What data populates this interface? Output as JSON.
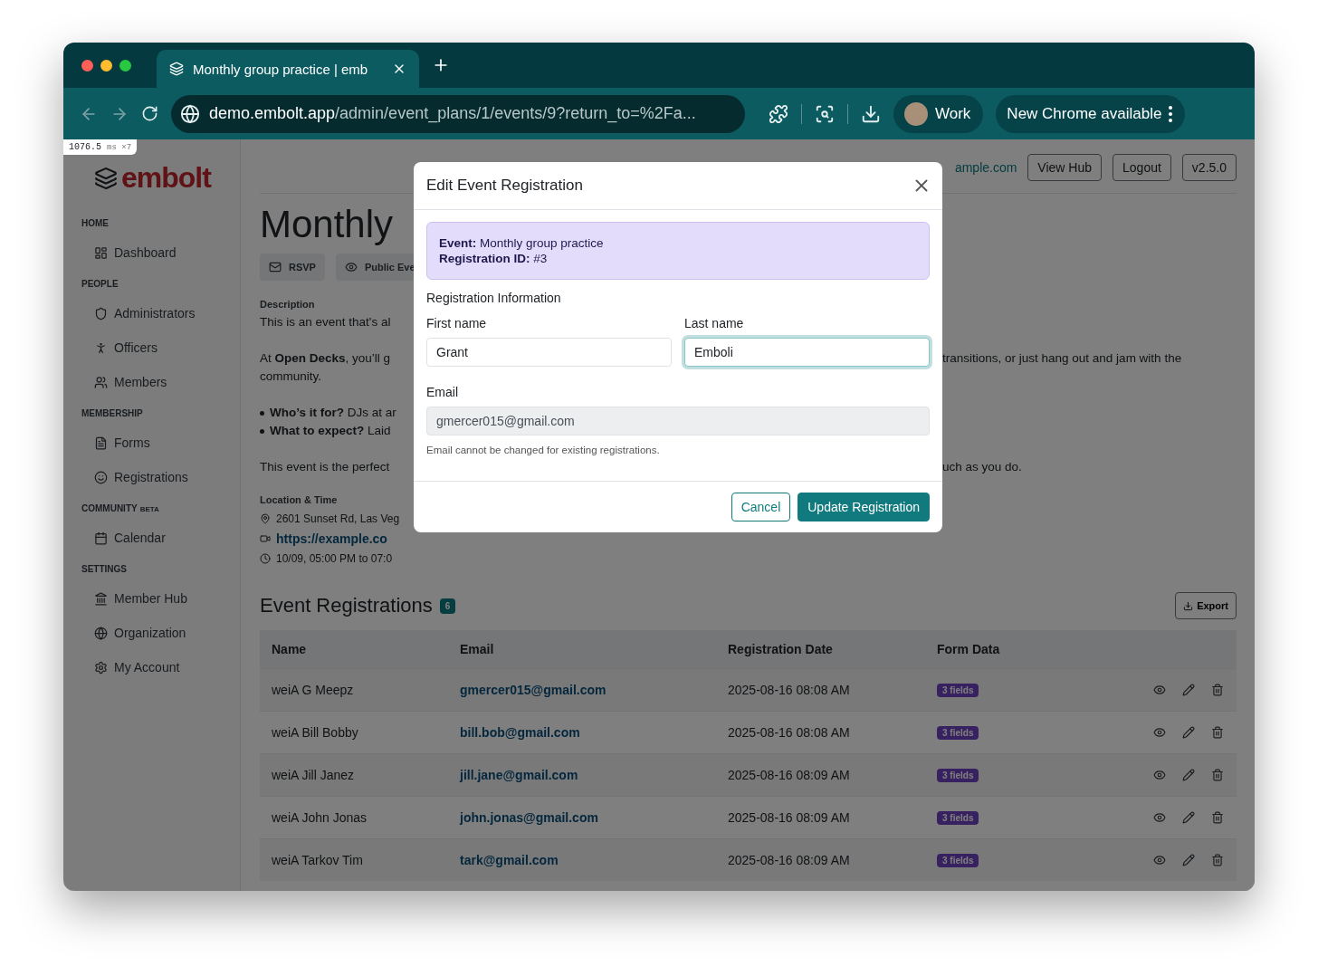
{
  "browser": {
    "tab": {
      "title": "Monthly group practice | emb",
      "selected": true
    },
    "address": {
      "host": "demo.embolt.app",
      "path": "/admin/event_plans/1/events/9?return_to=%2Fa..."
    },
    "profile": "Work",
    "update_button": "New Chrome available"
  },
  "perf_badge": {
    "value": "1076.5",
    "unit": "ms",
    "count": "×7"
  },
  "sidebar": {
    "logo": "embolt",
    "sections": [
      {
        "heading": "HOME",
        "items": [
          "Dashboard"
        ]
      },
      {
        "heading": "PEOPLE",
        "items": [
          "Administrators",
          "Officers",
          "Members"
        ]
      },
      {
        "heading": "MEMBERSHIP",
        "items": [
          "Forms",
          "Registrations"
        ]
      },
      {
        "heading": "COMMUNITY",
        "tag": "BETA",
        "items": [
          "Calendar"
        ]
      },
      {
        "heading": "SETTINGS",
        "items": [
          "Member Hub",
          "Organization",
          "My Account"
        ]
      }
    ]
  },
  "header": {
    "link": "ample.com",
    "buttons": [
      "View Hub",
      "Logout",
      "v2.5.0"
    ]
  },
  "event": {
    "title": "Monthly",
    "chips": [
      "RSVP",
      "Public Eve"
    ],
    "description_label": "Description",
    "blocks": [
      {
        "kind": "text",
        "lines": [
          {
            "left": "This is an event that's al"
          }
        ]
      },
      {
        "kind": "text",
        "lines": [
          {
            "left": "At **Open Decks**, you’ll g",
            "right": "transitions, or just hang out and jam with the"
          },
          {
            "left": "community."
          }
        ]
      },
      {
        "kind": "list",
        "lines": [
          {
            "left": "**Who’s it for?** DJs at ar"
          },
          {
            "left": "**What to expect?** Laid"
          }
        ]
      },
      {
        "kind": "text",
        "lines": [
          {
            "left": "This event is the perfect",
            "right": "uch as you do."
          }
        ]
      }
    ],
    "location_label": "Location & Time",
    "location": [
      {
        "kind": "address",
        "text": "2601 Sunset Rd, Las Veg"
      },
      {
        "kind": "link",
        "text": "https://example.co"
      },
      {
        "kind": "time",
        "text": "10/09, 05:00 PM to 07:0"
      }
    ]
  },
  "registrations": {
    "title": "Event Registrations",
    "count": "6",
    "export": "Export",
    "columns": [
      "Name",
      "Email",
      "Registration Date",
      "Form Data"
    ],
    "rows": [
      {
        "name": "weiA G Meepz",
        "email": "gmercer015@gmail.com",
        "date": "2025-08-16 08:08 AM",
        "form_data": "3 fields"
      },
      {
        "name": "weiA Bill Bobby",
        "email": "bill.bob@gmail.com",
        "date": "2025-08-16 08:08 AM",
        "form_data": "3 fields"
      },
      {
        "name": "weiA Jill Janez",
        "email": "jill.jane@gmail.com",
        "date": "2025-08-16 08:09 AM",
        "form_data": "3 fields"
      },
      {
        "name": "weiA John Jonas",
        "email": "john.jonas@gmail.com",
        "date": "2025-08-16 08:09 AM",
        "form_data": "3 fields"
      },
      {
        "name": "weiA Tarkov Tim",
        "email": "tark@gmail.com",
        "date": "2025-08-16 08:09 AM",
        "form_data": "3 fields"
      }
    ]
  },
  "modal": {
    "title": "Edit Event Registration",
    "info": [
      {
        "label": "Event:",
        "value": "Monthly group practice"
      },
      {
        "label": "Registration ID:",
        "value": "#3"
      }
    ],
    "section": "Registration Information",
    "fields": [
      {
        "label": "First name",
        "value": "Grant",
        "focused": false,
        "disabled": false
      },
      {
        "label": "Last name",
        "value": "Emboli",
        "focused": true,
        "disabled": false
      },
      {
        "label": "Email",
        "value": "gmercer015@gmail.com",
        "focused": false,
        "disabled": true
      }
    ],
    "help": "Email cannot be changed for existing registrations.",
    "buttons": [
      {
        "label": "Cancel",
        "kind": "secondary"
      },
      {
        "label": "Update Registration",
        "kind": "primary"
      }
    ]
  }
}
